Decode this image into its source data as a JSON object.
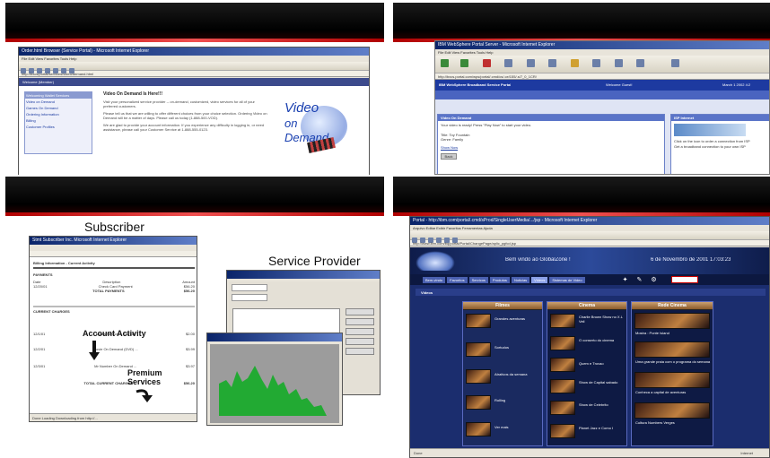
{
  "panel1": {
    "window_title": "Order.html Browser (Service Portal) - Microsoft Internet Explorer",
    "menu": "File  Edit  View  Favorites  Tools  Help",
    "address": "http://bxcs/portal/services/video/demand.html",
    "welcome": "Welcome (Member)",
    "sidebar_items": [
      "Welcoming Wallet Services",
      "Video on Demand",
      "Games On Demand",
      "Ordering Information",
      "Billing",
      "Customer Profiles"
    ],
    "headline": "Video On Demand Is Here!!!",
    "paragraph1": "Visit your personalized service provider -- on-demand, customized, video services for all of your preferred customers.",
    "paragraph2": "Please tell us that we are willing to offer different choices from your choice selection. Ordering Video on Demand will be a matter of days. Please call us today (1-888-500-VOD).",
    "paragraph3": "We are glad to provide your account information. If you experience any difficulty in logging in, or need assistance, please call your Customer Service at 1-888-555-0123.",
    "logo_word1": "Video",
    "logo_word2": "on",
    "logo_word3": "Demand"
  },
  "panel2": {
    "window_title": "IBM WebSphere Portal Server - Microsoft Internet Explorer",
    "menu": "File  Edit  View  Favorites  Tools  Help",
    "toolbar_labels": [
      "Back",
      "Forward",
      "Stop",
      "Refresh",
      "Home",
      "Search",
      "Favorites",
      "History",
      "Mail",
      "Print",
      "Edit",
      "Discuss",
      "RealGuide"
    ],
    "address": "http://bxcs.portal.com/wps/portal/.cmd/cs/.ce/155/.s/7_0_1CR/",
    "banner_title": "IBM WebSphere Broadband Service Portal",
    "banner_user": "Welcome Guest!",
    "banner_date": "March 1 2002  4:2",
    "portlet1_title": "Video On Demand",
    "portlet1_text": "Your video is ready! Press \"Play Now\" to start your video.",
    "portlet1_line2": "Title: Toy Fountain",
    "portlet1_line3": "Genre: Family",
    "portlet1_link": "Show Now",
    "portlet1_button": "Back",
    "portlet2_title": "ISP Internet",
    "portlet2_text": "Click on the icon to order a connection from ISP",
    "portlet2_line2": "Get a broadband connection to your own ISP"
  },
  "panel3": {
    "label_subscriber": "Subscriber",
    "label_provider": "Service Provider",
    "callout_account": "Account Activity",
    "callout_premium": "Premium\nServices",
    "bill_title": "Stmt Subscriber Inc. Microsoft Internet Explorer",
    "bill_heading": "Billing Information - Current Activity",
    "bill_section1": "PAYMENTS",
    "bill_section2": "CURRENT CHARGES",
    "bill_cols": [
      "Date",
      "Description",
      "Amount"
    ],
    "bill_rows": [
      [
        "12/20/01",
        "Check Card Payment",
        "$56.20"
      ],
      [
        "",
        "TOTAL PAYMENTS",
        "$56.20"
      ],
      [
        "12/1/01",
        "Movie Service ... (Jan 8)",
        "$2.00"
      ],
      [
        "12/2/01",
        "Movie On Demand (DVD) ...",
        "$3.99"
      ],
      [
        "12/3/01",
        "Mr Number On Demand ...",
        "$3.97"
      ],
      [
        "",
        "TOTAL CURRENT CHARGES",
        "$56.20"
      ]
    ],
    "status_bar": "Done  Loading Downloading from http://..."
  },
  "panel4": {
    "window_title": "Portal - http://ibm.com/portal/.cmd/sProd/SingleUserMedia/.../jsp - Microsoft Internet Explorer",
    "menu": "Arquivo  Editar  Exibir  Favoritos  Ferramentas  Ajuda",
    "address": "http://www.ibm.com/bq/portal/Portal/ChangePage/aplic_pgfcd.jsp",
    "welcome": "Bem vindo ao GlobalZone !",
    "date": "6 de Novembro de 2001 17:03:23",
    "nav_tabs": [
      "Bem-vindo",
      "Favoritos",
      "Servicos",
      "Produtos",
      "Noticias",
      "Videos",
      "Sistemas de Video"
    ],
    "section": "Videos",
    "tile1_head": "Filmes",
    "tile1_items": [
      "Grandes aventuras",
      "Sortudos",
      "Atrativos da semana",
      "Rolling",
      "Ver mais"
    ],
    "tile2_head": "Cinema",
    "tile2_items": [
      "Charlie Brown Show no X.L Veil",
      "O conserto do cinema",
      "Quem e Trovao",
      "Show de Capital sabado",
      "Show de Celebrito",
      "Planet Jazz e Como I"
    ],
    "tile3_head": "Rede Cinema",
    "tile3_items": [
      "Mostra : Ponte Island",
      "Uma grande praia com o programa do semana",
      "Conheca a capital de aventuras",
      "Cultura Numbers Verges"
    ],
    "status_left": "Done",
    "status_right": "Internet",
    "colors": {
      "portal_bg": "#1b2d6e",
      "brand_red": "#c80000"
    }
  },
  "icons": [
    "ie-logo-icon",
    "globe-icon",
    "arrow-down-icon",
    "curved-arrow-icon",
    "satellite-icon"
  ]
}
